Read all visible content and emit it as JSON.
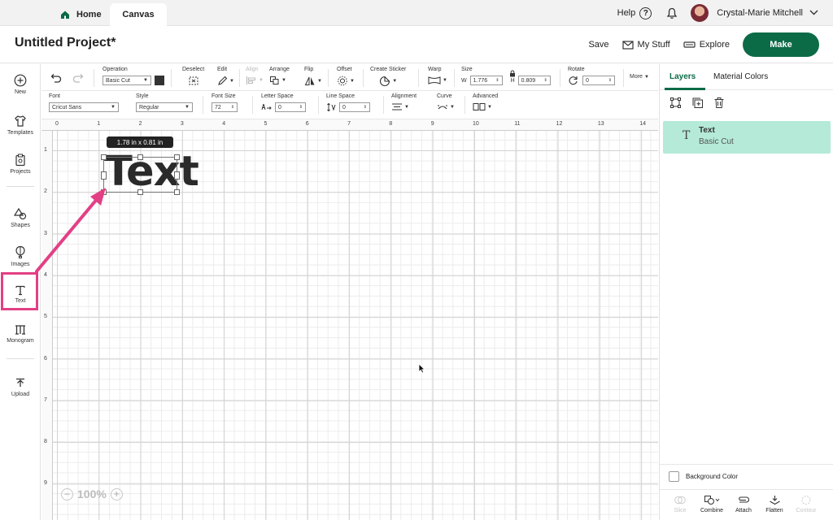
{
  "tabs": {
    "home": "Home",
    "canvas": "Canvas"
  },
  "top_right": {
    "help": "Help",
    "user_name": "Crystal-Marie Mitchell"
  },
  "project": {
    "title": "Untitled Project*",
    "save": "Save",
    "my_stuff": "My Stuff",
    "explore": "Explore",
    "make": "Make"
  },
  "sidebar": {
    "new": "New",
    "templates": "Templates",
    "projects": "Projects",
    "shapes": "Shapes",
    "images": "Images",
    "text": "Text",
    "monogram": "Monogram",
    "upload": "Upload"
  },
  "toolbar1": {
    "operation_label": "Operation",
    "operation_value": "Basic Cut",
    "deselect": "Deselect",
    "edit": "Edit",
    "align": "Align",
    "arrange": "Arrange",
    "flip": "Flip",
    "offset": "Offset",
    "create_sticker": "Create Sticker",
    "warp": "Warp",
    "size": "Size",
    "w_label": "W",
    "w_value": "1.776",
    "h_label": "H",
    "h_value": "0.809",
    "rotate": "Rotate",
    "rotate_value": "0",
    "more": "More"
  },
  "toolbar2": {
    "font_label": "Font",
    "font_value": "Cricut Sans",
    "style_label": "Style",
    "style_value": "Regular",
    "font_size_label": "Font Size",
    "font_size_value": "72",
    "letter_space_label": "Letter Space",
    "letter_space_value": "0",
    "line_space_label": "Line Space",
    "line_space_value": "0",
    "alignment_label": "Alignment",
    "curve_label": "Curve",
    "advanced_label": "Advanced"
  },
  "ruler": {
    "top": [
      "0",
      "1",
      "2",
      "3",
      "4",
      "5",
      "6",
      "7",
      "8",
      "9",
      "10",
      "11",
      "12",
      "13",
      "14"
    ],
    "left": [
      "1",
      "2",
      "3",
      "4",
      "5",
      "6",
      "7",
      "8",
      "9"
    ]
  },
  "canvas": {
    "dimension_tooltip": "1.78  in x 0.81  in",
    "text_object": "Text",
    "zoom": "100%"
  },
  "panel": {
    "tab_layers": "Layers",
    "tab_material": "Material Colors",
    "layer_name": "Text",
    "layer_sub": "Basic Cut",
    "background_color": "Background Color",
    "actions": {
      "slice": "Slice",
      "combine": "Combine",
      "attach": "Attach",
      "flatten": "Flatten",
      "contour": "Contour"
    }
  },
  "colors": {
    "brand_green": "#0c6b47",
    "layer_highlight": "#b4ead7",
    "annotation_pink": "#e33f85"
  }
}
